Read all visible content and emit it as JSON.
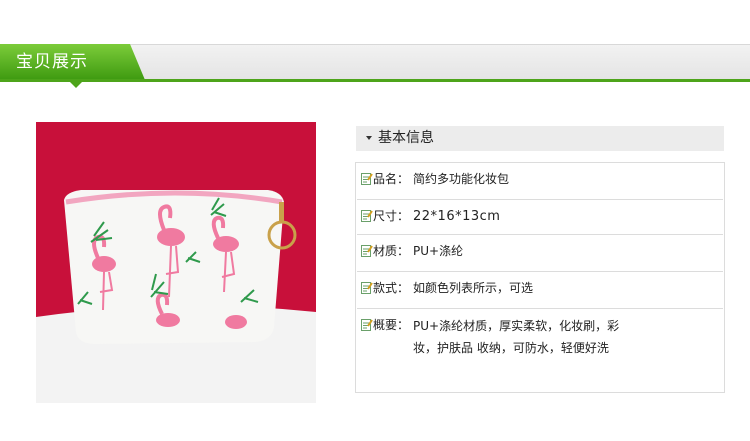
{
  "header": {
    "title": "宝贝展示",
    "accent_color": "#4da41a"
  },
  "product_image": {
    "alt": "flamingo-cosmetic-bag-photo"
  },
  "info": {
    "title": "基本信息",
    "rows": [
      {
        "label": "品名：",
        "value": "简约多功能化妆包",
        "icon": "note-pencil-icon"
      },
      {
        "label": "尺寸：",
        "value": "22*16*13cm",
        "icon": "note-pencil-icon"
      },
      {
        "label": "材质：",
        "value": "PU+涤纶",
        "icon": "note-pencil-icon"
      },
      {
        "label": "款式：",
        "value": "如颜色列表所示，可选",
        "icon": "note-pencil-icon"
      },
      {
        "label": "概要：",
        "value": "PU+涤纶材质，厚实柔软，化妆刷，彩妆，护肤品 收纳，可防水，轻便好洗",
        "icon": "note-pencil-icon"
      }
    ]
  }
}
